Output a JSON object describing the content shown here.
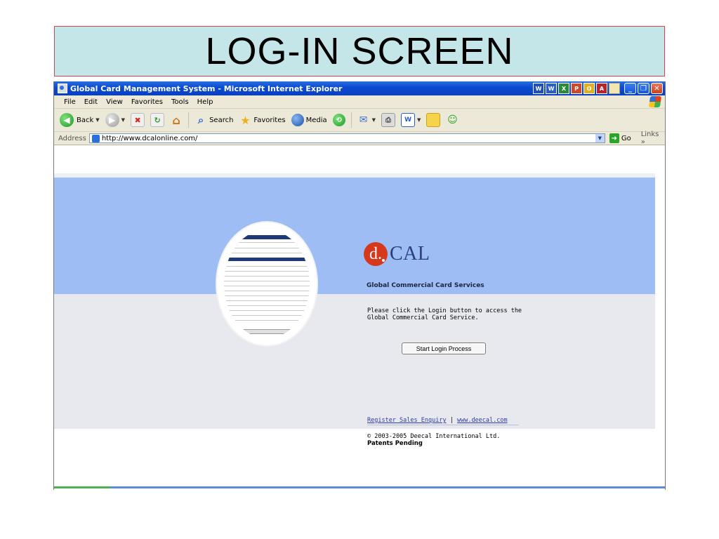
{
  "slide": {
    "title": "LOG-IN SCREEN"
  },
  "window": {
    "title": "Global Card Management System - Microsoft Internet Explorer",
    "tray_icons": [
      "W",
      "W",
      "X",
      "P",
      "O",
      "A",
      ""
    ]
  },
  "menu": [
    "File",
    "Edit",
    "View",
    "Favorites",
    "Tools",
    "Help"
  ],
  "toolbar": {
    "back_label": "Back",
    "search_label": "Search",
    "favorites_label": "Favorites",
    "media_label": "Media"
  },
  "address": {
    "label": "Address",
    "url": "http://www.dcalonline.com/",
    "go_label": "Go",
    "links_label": "Links"
  },
  "page": {
    "logo_letter": "d.",
    "logo_text": "CAL",
    "tagline": "Global Commercial Card Services",
    "message_line1": "Please click the Login button to access the",
    "message_line2": "Global Commercial Card Service.",
    "login_button": "Start Login Process",
    "link_register": "Register Sales Enquiry",
    "link_separator": "|",
    "link_site": "www.deecal.com",
    "copyright": "© 2003-2005 Deecal International Ltd.",
    "patents": "Patents Pending"
  },
  "colors": {
    "slide_title_bg": "#c5e6e9",
    "blue_band": "#9dbdf4",
    "grey_band": "#e8e9ee",
    "logo_red": "#d6381b",
    "logo_navy": "#2a3f7b"
  }
}
